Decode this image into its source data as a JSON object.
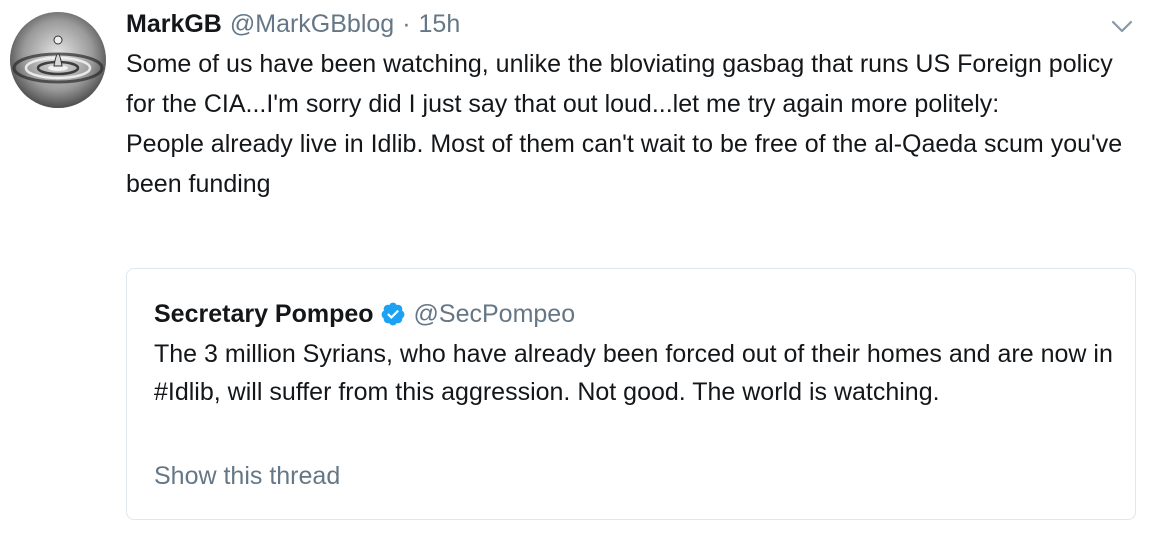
{
  "tweet": {
    "author_name": "MarkGB",
    "author_handle": "@MarkGBblog",
    "separator": "·",
    "time": "15h",
    "text": "Some of us have been watching, unlike the bloviating gasbag that runs US Foreign policy for the CIA...I'm sorry did I just say that out loud...let me try again more politely:\nPeople already live in Idlib. Most of them can't wait to be free of the al-Qaeda scum you've been funding",
    "caret_icon": "chevron-down-icon",
    "avatar_icon": "water-drop-avatar"
  },
  "quoted_tweet": {
    "author_name": "Secretary Pompeo",
    "verified_icon": "verified-badge-icon",
    "verified_color": "#1da1f2",
    "author_handle": "@SecPompeo",
    "text": "The 3 million Syrians, who have already been forced out of their homes and are now in #Idlib, will suffer from this aggression. Not good. The world is watching.",
    "show_thread_label": "Show this thread"
  },
  "colors": {
    "primary_text": "#14171a",
    "secondary_text": "#657786",
    "border": "#e1e8ed",
    "background": "#ffffff"
  }
}
